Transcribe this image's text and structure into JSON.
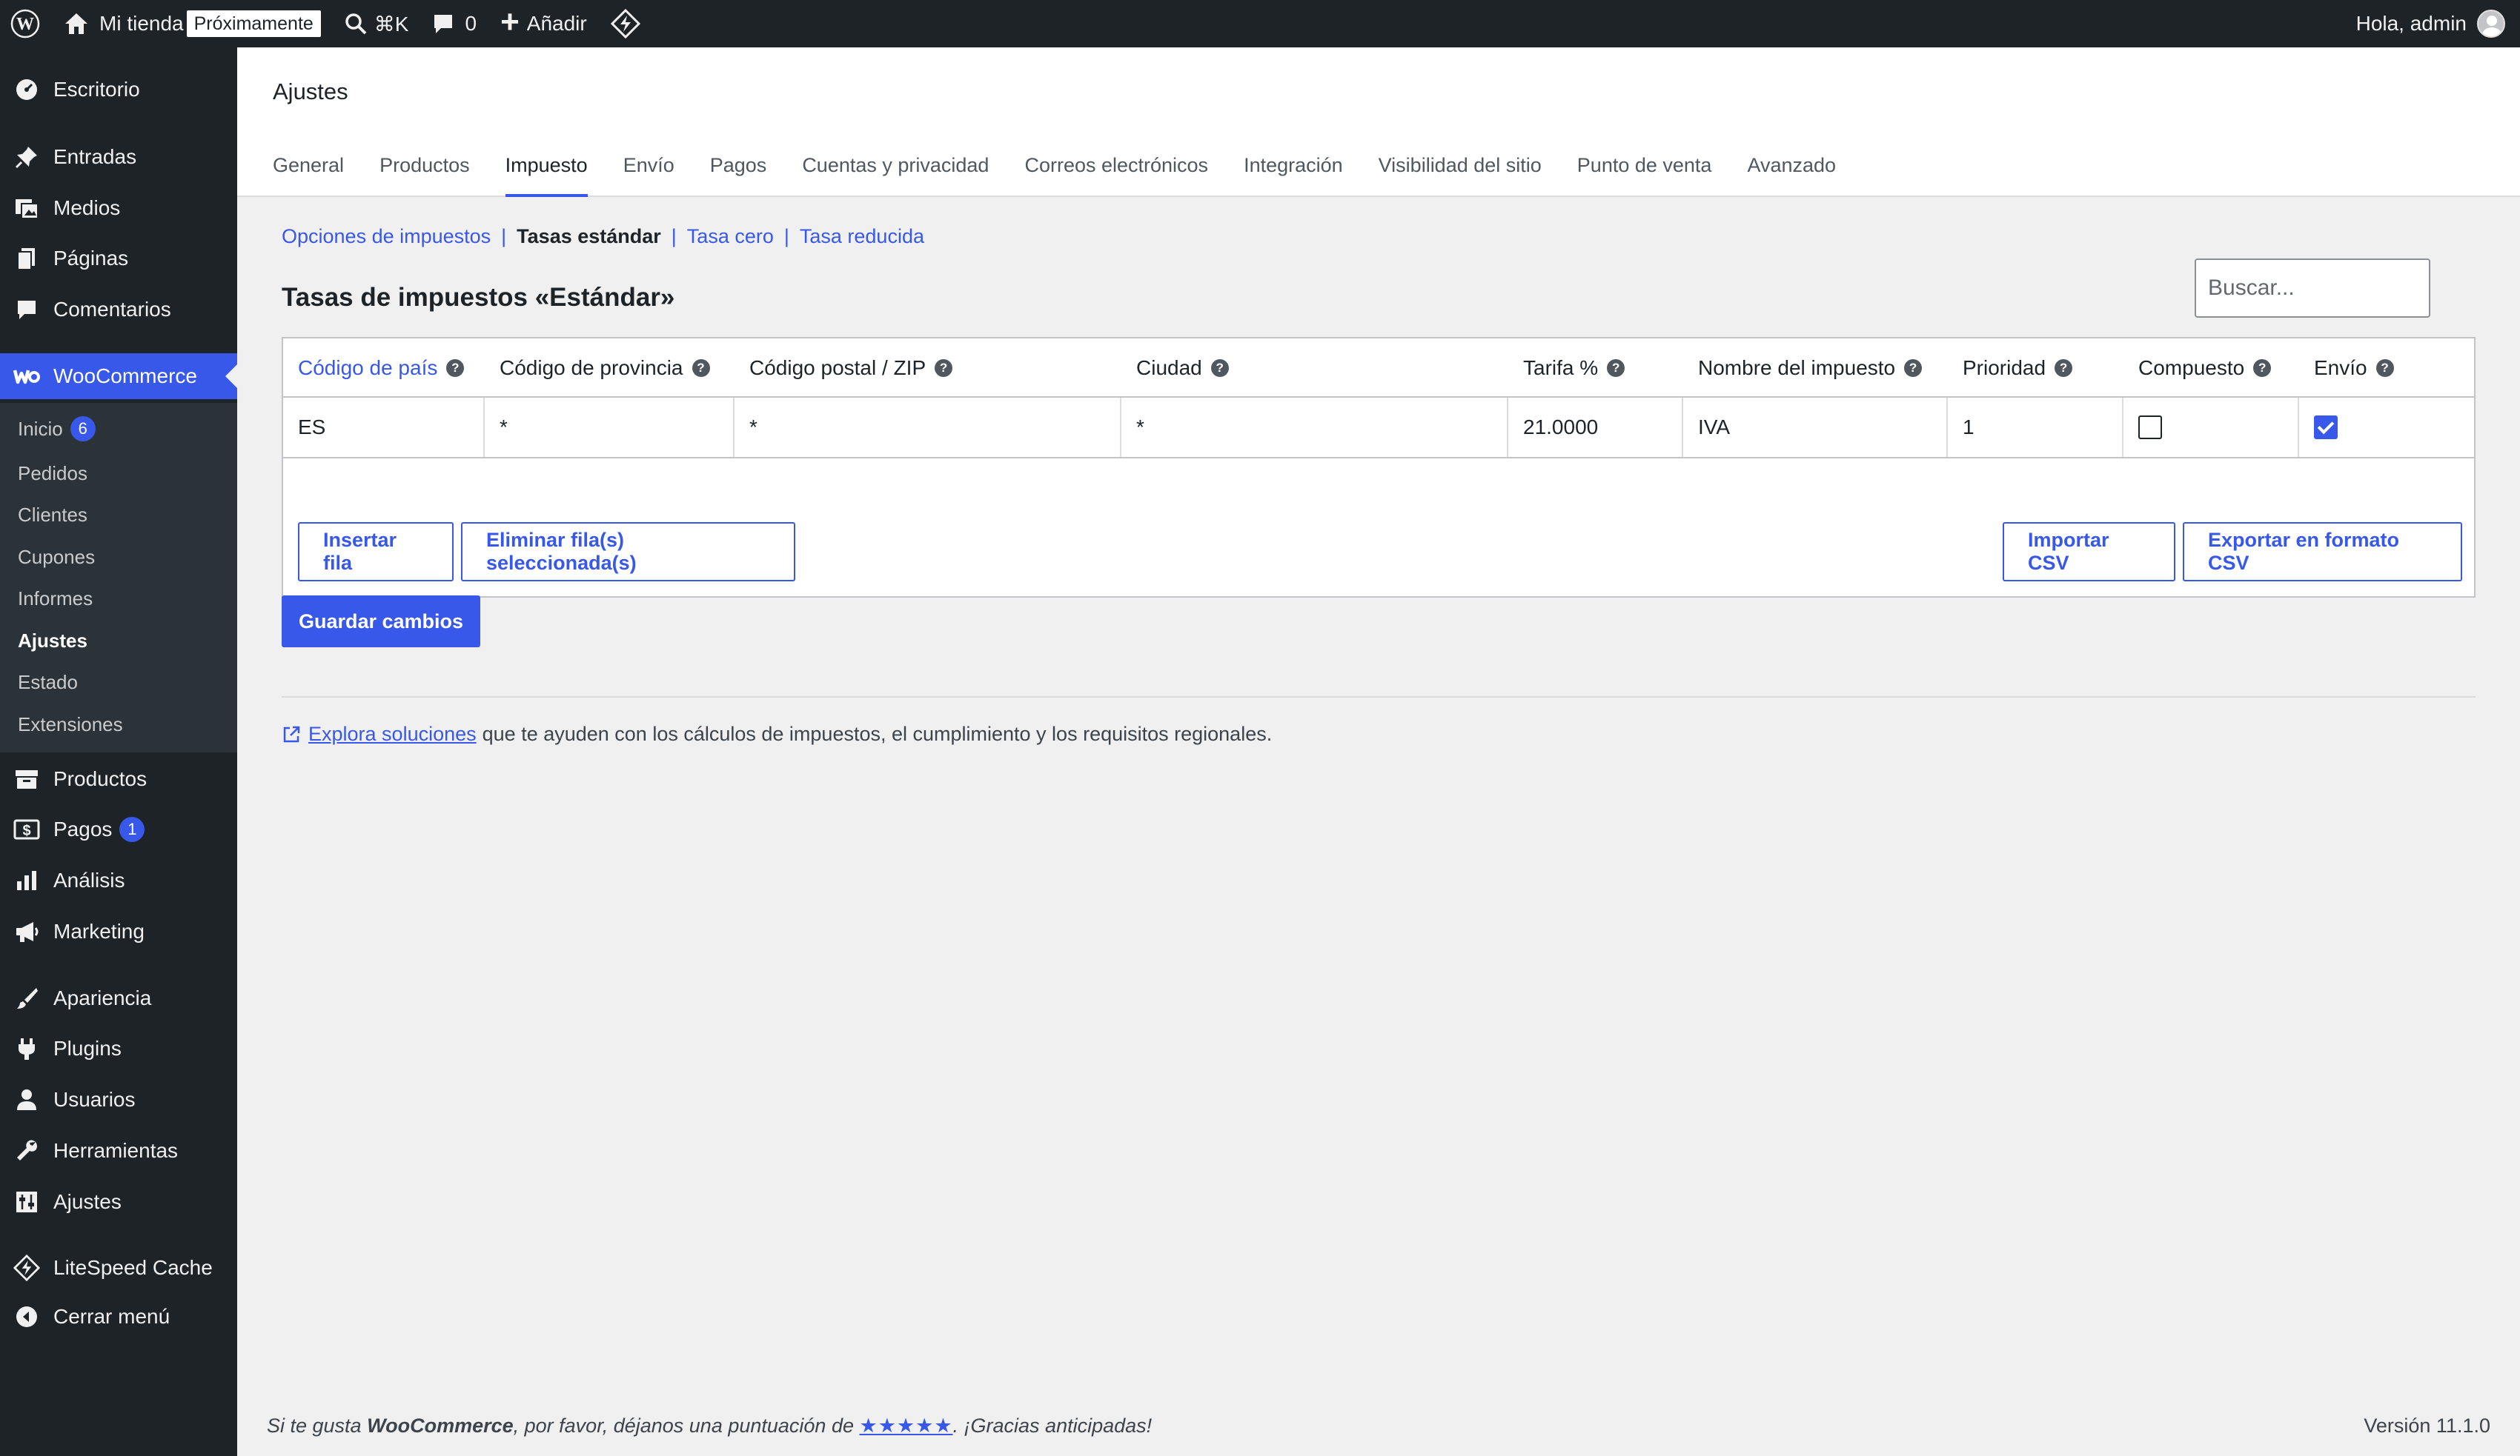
{
  "admin_bar": {
    "site_name": "Mi tienda",
    "status_badge": "Próximamente",
    "search_shortcut": "⌘K",
    "comments_count": "0",
    "new_label": "Añadir",
    "greeting": "Hola, admin"
  },
  "sidebar": {
    "items": [
      {
        "label": "Escritorio",
        "icon": "dashboard-icon"
      },
      {
        "label": "Entradas",
        "icon": "pin-icon"
      },
      {
        "label": "Medios",
        "icon": "media-icon"
      },
      {
        "label": "Páginas",
        "icon": "pages-icon"
      },
      {
        "label": "Comentarios",
        "icon": "comment-icon"
      },
      {
        "label": "WooCommerce",
        "icon": "woo-icon"
      },
      {
        "label": "Productos",
        "icon": "archive-icon"
      },
      {
        "label": "Pagos",
        "icon": "payments-icon",
        "badge": "1"
      },
      {
        "label": "Análisis",
        "icon": "chart-icon"
      },
      {
        "label": "Marketing",
        "icon": "megaphone-icon"
      },
      {
        "label": "Apariencia",
        "icon": "brush-icon"
      },
      {
        "label": "Plugins",
        "icon": "plugin-icon"
      },
      {
        "label": "Usuarios",
        "icon": "user-icon"
      },
      {
        "label": "Herramientas",
        "icon": "wrench-icon"
      },
      {
        "label": "Ajustes",
        "icon": "settings-icon"
      },
      {
        "label": "LiteSpeed Cache",
        "icon": "litespeed-icon"
      },
      {
        "label": "Cerrar menú",
        "icon": "collapse-icon"
      }
    ],
    "woo_submenu": [
      {
        "label": "Inicio",
        "badge": "6"
      },
      {
        "label": "Pedidos"
      },
      {
        "label": "Clientes"
      },
      {
        "label": "Cupones"
      },
      {
        "label": "Informes"
      },
      {
        "label": "Ajustes"
      },
      {
        "label": "Estado"
      },
      {
        "label": "Extensiones"
      }
    ]
  },
  "page": {
    "title": "Ajustes",
    "tabs": [
      "General",
      "Productos",
      "Impuesto",
      "Envío",
      "Pagos",
      "Cuentas y privacidad",
      "Correos electrónicos",
      "Integración",
      "Visibilidad del sitio",
      "Punto de venta",
      "Avanzado"
    ],
    "active_tab": "Impuesto",
    "subnav": [
      "Opciones de impuestos",
      "Tasas estándar",
      "Tasa cero",
      "Tasa reducida"
    ],
    "section_title": "Tasas de impuestos «Estándar»",
    "search_placeholder": "Buscar...",
    "table": {
      "headers": [
        "Código de país",
        "Código de provincia",
        "Código postal / ZIP",
        "Ciudad",
        "Tarifa %",
        "Nombre del impuesto",
        "Prioridad",
        "Compuesto",
        "Envío"
      ],
      "rows": [
        {
          "country": "ES",
          "state": "*",
          "postcode": "*",
          "city": "*",
          "rate": "21.0000",
          "name": "IVA",
          "priority": "1",
          "compound": false,
          "shipping": true
        }
      ]
    },
    "buttons": {
      "insert_row": "Insertar fila",
      "remove_rows": "Eliminar fila(s) seleccionada(s)",
      "import_csv": "Importar CSV",
      "export_csv": "Exportar en formato CSV",
      "save": "Guardar cambios"
    },
    "explore": {
      "link": "Explora soluciones",
      "text": "que te ayuden con los cálculos de impuestos, el cumplimiento y los requisitos regionales."
    }
  },
  "footer": {
    "pre": "Si te gusta ",
    "brand": "WooCommerce",
    "mid": ", por favor, déjanos una puntuación de ",
    "stars": "★★★★★",
    "post": ". ¡Gracias anticipadas!",
    "version": "Versión 11.1.0"
  },
  "colors": {
    "accent": "#3858e9",
    "admin_bg": "#1d2327",
    "submenu_bg": "#2c3338",
    "page_bg": "#f0f0f1"
  }
}
